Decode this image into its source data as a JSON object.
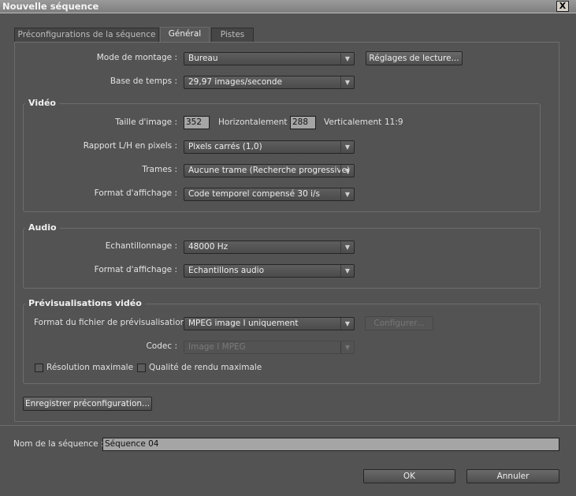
{
  "window": {
    "title": "Nouvelle séquence",
    "close": "X"
  },
  "tabs": [
    {
      "label": "Préconfigurations de la séquence"
    },
    {
      "label": "Général"
    },
    {
      "label": "Pistes"
    }
  ],
  "general": {
    "mode_label": "Mode de montage :",
    "mode_value": "Bureau",
    "playback_button": "Réglages de lecture...",
    "timebase_label": "Base de temps :",
    "timebase_value": "29,97 images/seconde"
  },
  "video": {
    "title": "Vidéo",
    "frame_size_label": "Taille d'image :",
    "width": "352",
    "horizontal": "Horizontalement",
    "height": "288",
    "vertical": "Verticalement",
    "ratio": "11:9",
    "par_label": "Rapport L/H en pixels :",
    "par_value": "Pixels carrés (1,0)",
    "fields_label": "Trames :",
    "fields_value": "Aucune trame (Recherche progressive)",
    "display_label": "Format d'affichage :",
    "display_value": "Code temporel compensé 30 i/s"
  },
  "audio": {
    "title": "Audio",
    "rate_label": "Echantillonnage :",
    "rate_value": "48000 Hz",
    "display_label": "Format d'affichage :",
    "display_value": "Echantillons audio"
  },
  "preview": {
    "title": "Prévisualisations vidéo",
    "format_label": "Format du fichier de prévisualisation :",
    "format_value": "MPEG image I uniquement",
    "configure": "Configurer...",
    "codec_label": "Codec :",
    "codec_value": "Image I MPEG",
    "max_res": "Résolution maximale",
    "max_quality": "Qualité de rendu maximale"
  },
  "save_preset": "Enregistrer préconfiguration...",
  "sequence_name": {
    "label": "Nom de la séquence :",
    "value": "Séquence 04"
  },
  "ok": "OK",
  "cancel": "Annuler"
}
